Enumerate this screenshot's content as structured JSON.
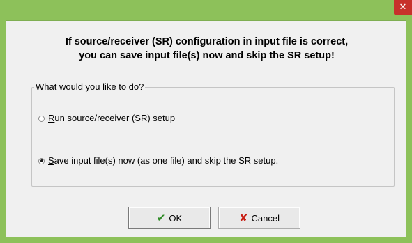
{
  "window": {
    "close_glyph": "✕",
    "accent_color": "#8dc15a",
    "close_color": "#c7312b"
  },
  "message": {
    "line1": "If source/receiver (SR) configuration in input file is correct,",
    "line2": "you can save input file(s) now and skip the SR setup!"
  },
  "group": {
    "legend": "What would you like to do?",
    "options": [
      {
        "accel": "R",
        "rest": "un source/receiver (SR) setup",
        "selected": false
      },
      {
        "accel": "S",
        "rest": "ave input file(s) now (as one file) and skip the SR setup.",
        "selected": true
      }
    ]
  },
  "buttons": {
    "ok": {
      "icon": "check-icon",
      "glyph": "✔",
      "label": "OK"
    },
    "cancel": {
      "icon": "x-icon",
      "glyph": "✘",
      "label": "Cancel"
    }
  }
}
